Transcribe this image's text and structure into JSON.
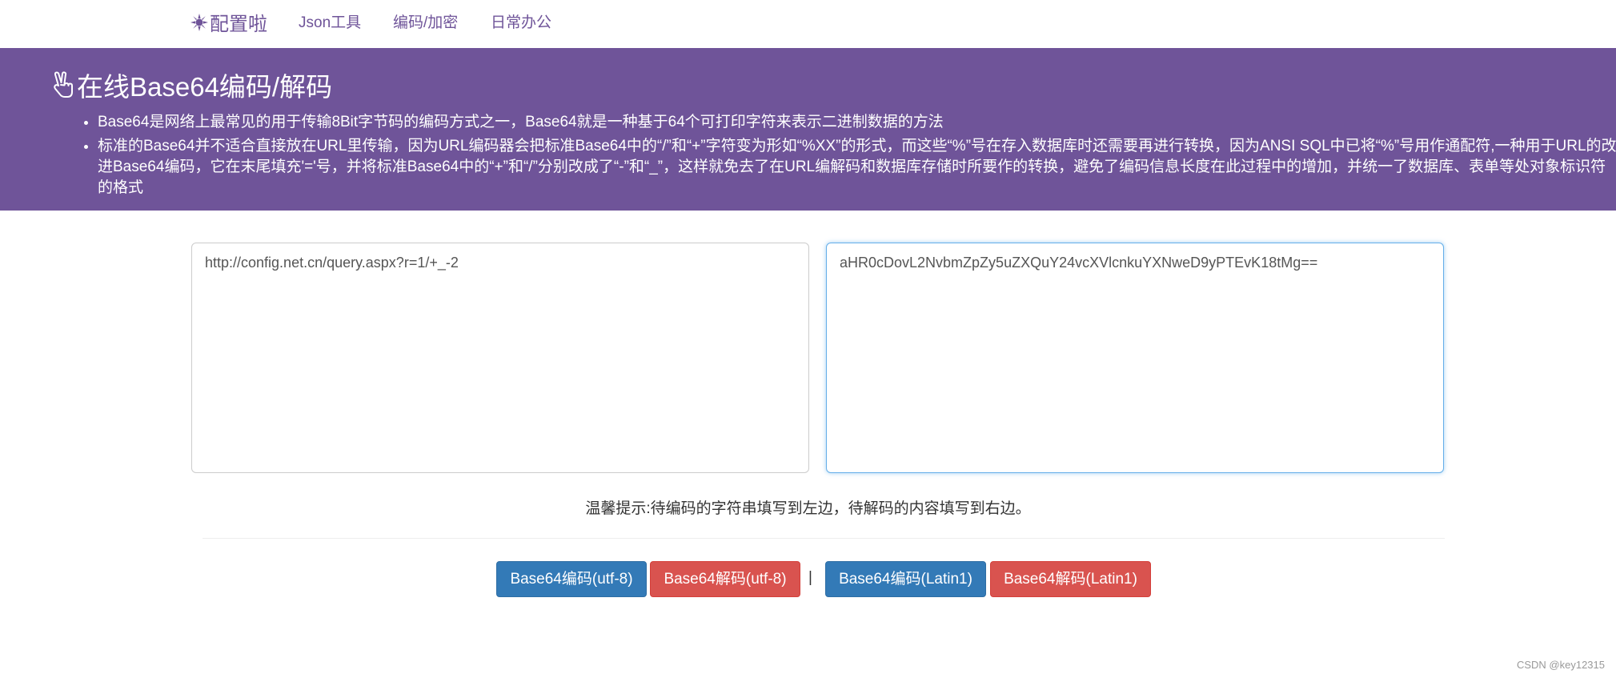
{
  "navbar": {
    "brand": "配置啦",
    "brand_icon": "sunburst-logo-icon",
    "links": [
      "Json工具",
      "编码/加密",
      "日常办公"
    ]
  },
  "hero": {
    "title": "在线Base64编码/解码",
    "title_icon": "victory-hand-icon",
    "bullets": [
      "Base64是网络上最常见的用于传输8Bit字节码的编码方式之一，Base64就是一种基于64个可打印字符来表示二进制数据的方法",
      "标准的Base64并不适合直接放在URL里传输，因为URL编码器会把标准Base64中的“/”和“+”字符变为形如“%XX”的形式，而这些“%”号在存入数据库时还需要再进行转换，因为ANSI SQL中已将“%”号用作通配符,一种用于URL的改进Base64编码，它在末尾填充'='号，并将标准Base64中的“+”和“/”分别改成了“-”和“_”，这样就免去了在URL编解码和数据库存储时所要作的转换，避免了编码信息长度在此过程中的增加，并统一了数据库、表单等处对象标识符的格式"
    ]
  },
  "editor": {
    "left_value": "http://config.net.cn/query.aspx?r=1/+_-2",
    "right_value": "aHR0cDovL2NvbmZpZy5uZXQuY24vcXVlcnkuYXNweD9yPTEvK18tMg=="
  },
  "hint": "温馨提示:待编码的字符串填写到左边，待解码的内容填写到右边。",
  "buttons": {
    "encode_utf8": "Base64编码(utf-8)",
    "decode_utf8": "Base64解码(utf-8)",
    "separator": "|",
    "encode_latin1": "Base64编码(Latin1)",
    "decode_latin1": "Base64解码(Latin1)"
  },
  "watermark": "CSDN @key12315",
  "colors": {
    "primary_purple": "#6f5499",
    "btn_blue": "#337ab7",
    "btn_red": "#d9534f",
    "focus_border": "#66afe9"
  }
}
